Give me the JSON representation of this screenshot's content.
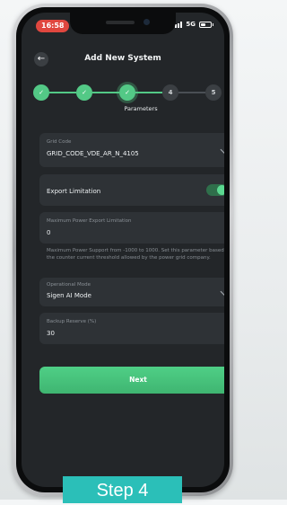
{
  "status_bar": {
    "time": "16:58",
    "network": "5G"
  },
  "header": {
    "title": "Add New System"
  },
  "stepper": {
    "steps": [
      "1",
      "2",
      "3",
      "4",
      "5"
    ],
    "current_step": 3,
    "current_label": "Parameters"
  },
  "form": {
    "grid_code": {
      "label": "Grid Code",
      "value": "GRID_CODE_VDE_AR_N_4105"
    },
    "export_limitation": {
      "label": "Export Limitation",
      "enabled": true
    },
    "max_export": {
      "label": "Maximum Power Export Limitation",
      "value": "0"
    },
    "max_export_help": "Maximum Power Support from -1000 to 1000. Set this parameter based on the counter current threshold allowed by the power grid company.",
    "operational_mode": {
      "label": "Operational Mode",
      "value": "Sigen AI Mode"
    },
    "backup_reserve": {
      "label": "Backup Reserve (%)",
      "value": "30"
    }
  },
  "actions": {
    "next_label": "Next"
  },
  "caption": "Step 4",
  "colors": {
    "accent": "#53c986",
    "screen_bg": "#232629",
    "card_bg": "#2e3236",
    "caption_bg": "#2bbfb8",
    "time_pill": "#e0473f"
  },
  "icons": {
    "back": "arrow-left-icon",
    "dropdown": "chevron-down-icon",
    "battery": "battery-icon",
    "signal": "signal-icon"
  }
}
